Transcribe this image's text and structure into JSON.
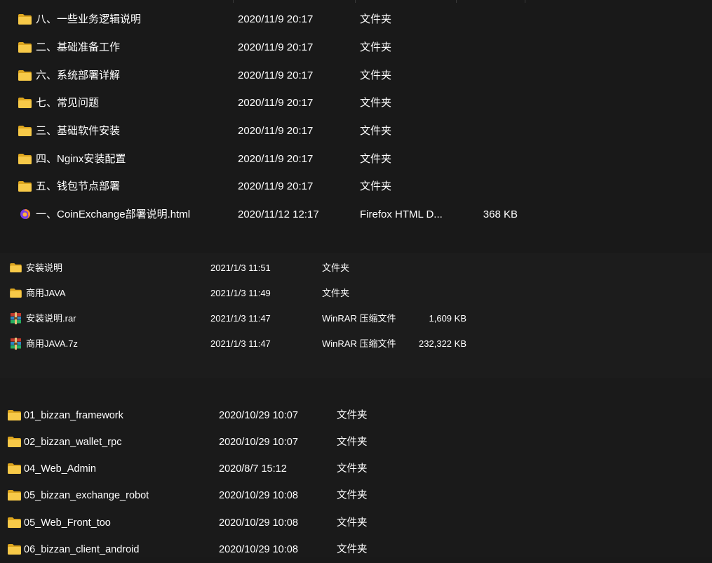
{
  "colors": {
    "background": "#191919",
    "text": "#ffffff",
    "folder": "#f7c948",
    "folder_dark": "#dca51f"
  },
  "panel_a": {
    "rows": [
      {
        "icon": "folder-icon",
        "name": "八、一些业务逻辑说明",
        "date": "2020/11/9 20:17",
        "type": "文件夹",
        "size": ""
      },
      {
        "icon": "folder-icon",
        "name": "二、基础准备工作",
        "date": "2020/11/9 20:17",
        "type": "文件夹",
        "size": ""
      },
      {
        "icon": "folder-icon",
        "name": "六、系统部署详解",
        "date": "2020/11/9 20:17",
        "type": "文件夹",
        "size": ""
      },
      {
        "icon": "folder-icon",
        "name": "七、常见问题",
        "date": "2020/11/9 20:17",
        "type": "文件夹",
        "size": ""
      },
      {
        "icon": "folder-icon",
        "name": "三、基础软件安装",
        "date": "2020/11/9 20:17",
        "type": "文件夹",
        "size": ""
      },
      {
        "icon": "folder-icon",
        "name": "四、Nginx安装配置",
        "date": "2020/11/9 20:17",
        "type": "文件夹",
        "size": ""
      },
      {
        "icon": "folder-icon",
        "name": "五、钱包节点部署",
        "date": "2020/11/9 20:17",
        "type": "文件夹",
        "size": ""
      },
      {
        "icon": "firefox-html-icon",
        "name": "一、CoinExchange部署说明.html",
        "date": "2020/11/12 12:17",
        "type": "Firefox HTML D...",
        "size": "368 KB"
      }
    ]
  },
  "panel_b": {
    "rows": [
      {
        "icon": "folder-icon",
        "name": "安装说明",
        "date": "2021/1/3 11:51",
        "type": "文件夹",
        "size": ""
      },
      {
        "icon": "folder-icon",
        "name": "商用JAVA",
        "date": "2021/1/3 11:49",
        "type": "文件夹",
        "size": ""
      },
      {
        "icon": "winrar-archive-icon",
        "name": "安装说明.rar",
        "date": "2021/1/3 11:47",
        "type": "WinRAR 压缩文件",
        "size": "1,609 KB"
      },
      {
        "icon": "winrar-archive-icon",
        "name": "商用JAVA.7z",
        "date": "2021/1/3 11:47",
        "type": "WinRAR 压缩文件",
        "size": "232,322 KB"
      }
    ]
  },
  "panel_c": {
    "rows": [
      {
        "icon": "folder-icon",
        "name": "01_bizzan_framework",
        "date": "2020/10/29 10:07",
        "type": "文件夹"
      },
      {
        "icon": "folder-icon",
        "name": "02_bizzan_wallet_rpc",
        "date": "2020/10/29 10:07",
        "type": "文件夹"
      },
      {
        "icon": "folder-icon",
        "name": "04_Web_Admin",
        "date": "2020/8/7 15:12",
        "type": "文件夹"
      },
      {
        "icon": "folder-icon",
        "name": "05_bizzan_exchange_robot",
        "date": "2020/10/29 10:08",
        "type": "文件夹"
      },
      {
        "icon": "folder-icon",
        "name": "05_Web_Front_too",
        "date": "2020/10/29 10:08",
        "type": "文件夹"
      },
      {
        "icon": "folder-icon",
        "name": "06_bizzan_client_android",
        "date": "2020/10/29 10:08",
        "type": "文件夹"
      }
    ]
  }
}
